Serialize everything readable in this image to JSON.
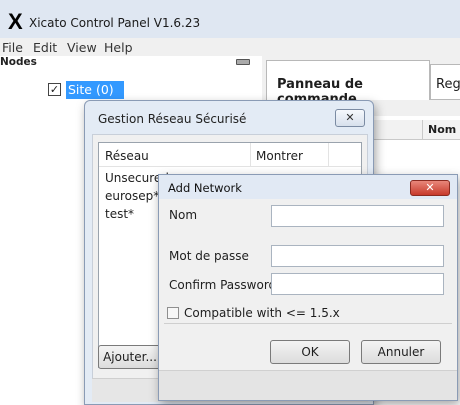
{
  "window": {
    "title": "Xicato Control Panel V1.6.23",
    "logo_glyph": "X"
  },
  "menu": [
    "File",
    "Edit",
    "View",
    "Help"
  ],
  "nodes_panel": {
    "header": "Nodes",
    "tree": {
      "label": "Site (0)",
      "checked": true,
      "check_glyph": "✓"
    }
  },
  "tabs": [
    {
      "label": "Panneau de commande"
    },
    {
      "label": "Reg"
    }
  ],
  "grid": {
    "column_nom": "Nom"
  },
  "secure_network_dialog": {
    "title": "Gestion Réseau Sécurisé",
    "close_glyph": "✕",
    "columns": {
      "reseau": "Réseau",
      "montrer": "Montrer"
    },
    "rows": [
      {
        "name": "Unsecured"
      },
      {
        "name": "eurosep*"
      },
      {
        "name": "test*"
      }
    ],
    "add_button": "Ajouter..."
  },
  "add_network_dialog": {
    "title": "Add Network",
    "close_glyph": "✕",
    "fields": {
      "name_label": "Nom",
      "name_value": "",
      "password_label": "Mot de passe",
      "password_value": "",
      "confirm_label": "Confirm Password",
      "confirm_value": ""
    },
    "compat_label": "Compatible with <= 1.5.x",
    "compat_checked": false,
    "ok_button": "OK",
    "cancel_button": "Annuler"
  },
  "colors": {
    "title_bar": "#dfe7f2",
    "selection": "#3399ff",
    "close_red": "#c73a2b"
  }
}
